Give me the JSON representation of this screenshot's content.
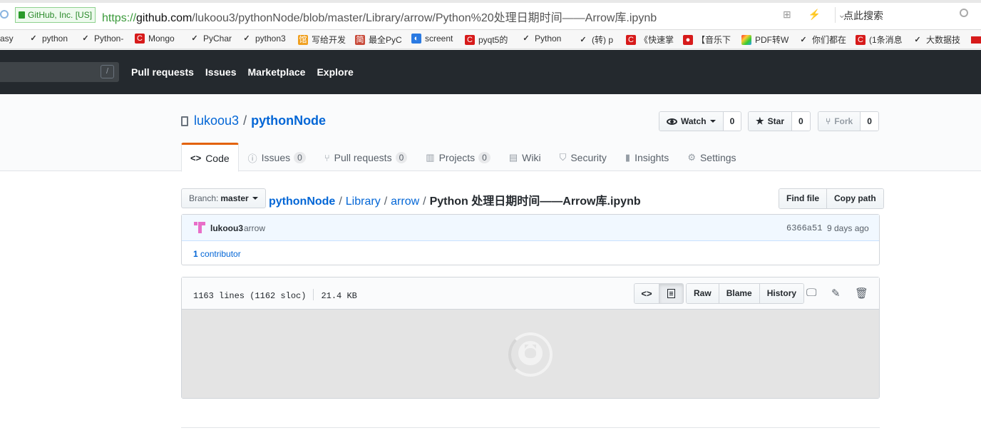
{
  "browser": {
    "cert_label": "GitHub, Inc. [US]",
    "url_proto": "https://",
    "url_host": "github.com",
    "url_path": "/lukoou3/pythonNode/blob/master/Library/arrow/Python%20处理日期时间——Arrow库.ipynb",
    "icons": "⊞ ⚡ ⌄",
    "search_placeholder": "点此搜索"
  },
  "bookmarks": [
    {
      "label": "asy",
      "icon": "folder-icon"
    },
    {
      "label": "python",
      "icon": "ws-icon"
    },
    {
      "label": "Python-",
      "icon": "ws-icon"
    },
    {
      "label": "Mongo",
      "icon": "csdn-icon"
    },
    {
      "label": "PyChar",
      "icon": "ws-icon"
    },
    {
      "label": "python3",
      "icon": "ws-icon"
    },
    {
      "label": "写给开发",
      "icon": "zhihu-icon"
    },
    {
      "label": "最全PyC",
      "icon": "jianshu-icon"
    },
    {
      "label": "screent",
      "icon": "blue-icon"
    },
    {
      "label": "pyqt5的",
      "icon": "csdn-icon"
    },
    {
      "label": "Python",
      "icon": "ws-icon"
    },
    {
      "label": "(转) p",
      "icon": "ws-icon"
    },
    {
      "label": "《快速掌",
      "icon": "csdn-icon"
    },
    {
      "label": "【音乐下",
      "icon": "red-icon"
    },
    {
      "label": "PDF转W",
      "icon": "pdf-icon"
    },
    {
      "label": "你们都在",
      "icon": "ws-icon"
    },
    {
      "label": "(1条消息",
      "icon": "csdn-icon"
    },
    {
      "label": "大数据技",
      "icon": "ws-icon"
    }
  ],
  "gh_nav": {
    "slash": "/",
    "items": [
      "Pull requests",
      "Issues",
      "Marketplace",
      "Explore"
    ]
  },
  "repo": {
    "owner": "lukoou3",
    "sep": "/",
    "name": "pythonNode",
    "watch_label": "Watch",
    "watch_count": "0",
    "star_label": "Star",
    "star_count": "0",
    "fork_label": "Fork",
    "fork_count": "0"
  },
  "tabs": [
    {
      "label": "Code",
      "icon": "<>",
      "counter": ""
    },
    {
      "label": "Issues",
      "icon": "ⓘ",
      "counter": "0"
    },
    {
      "label": "Pull requests",
      "icon": "⑂",
      "counter": "0"
    },
    {
      "label": "Projects",
      "icon": "▥",
      "counter": "0"
    },
    {
      "label": "Wiki",
      "icon": "▤",
      "counter": ""
    },
    {
      "label": "Security",
      "icon": "⛉",
      "counter": ""
    },
    {
      "label": "Insights",
      "icon": "▮",
      "counter": ""
    },
    {
      "label": "Settings",
      "icon": "⚙",
      "counter": ""
    }
  ],
  "filenav": {
    "branch_label": "Branch:",
    "branch_value": "master",
    "crumb_root": "pythonNode",
    "crumb_1": "Library",
    "crumb_2": "arrow",
    "crumb_file": "Python 处理日期时间——Arrow库.ipynb",
    "sep": "/",
    "find_file": "Find file",
    "copy_path": "Copy path"
  },
  "commit": {
    "author": "lukoou3",
    "message": "arrow",
    "sha": "6366a51",
    "time": "9 days ago",
    "contributors_count": "1",
    "contributors_label": "contributor"
  },
  "file": {
    "lines": "1163 lines (1162 sloc)",
    "size": "21.4 KB",
    "code_toggle": "<>",
    "raw": "Raw",
    "blame": "Blame",
    "history": "History",
    "desktop_icon": "🖵",
    "edit_icon": "✎",
    "delete_icon": "🗑"
  }
}
